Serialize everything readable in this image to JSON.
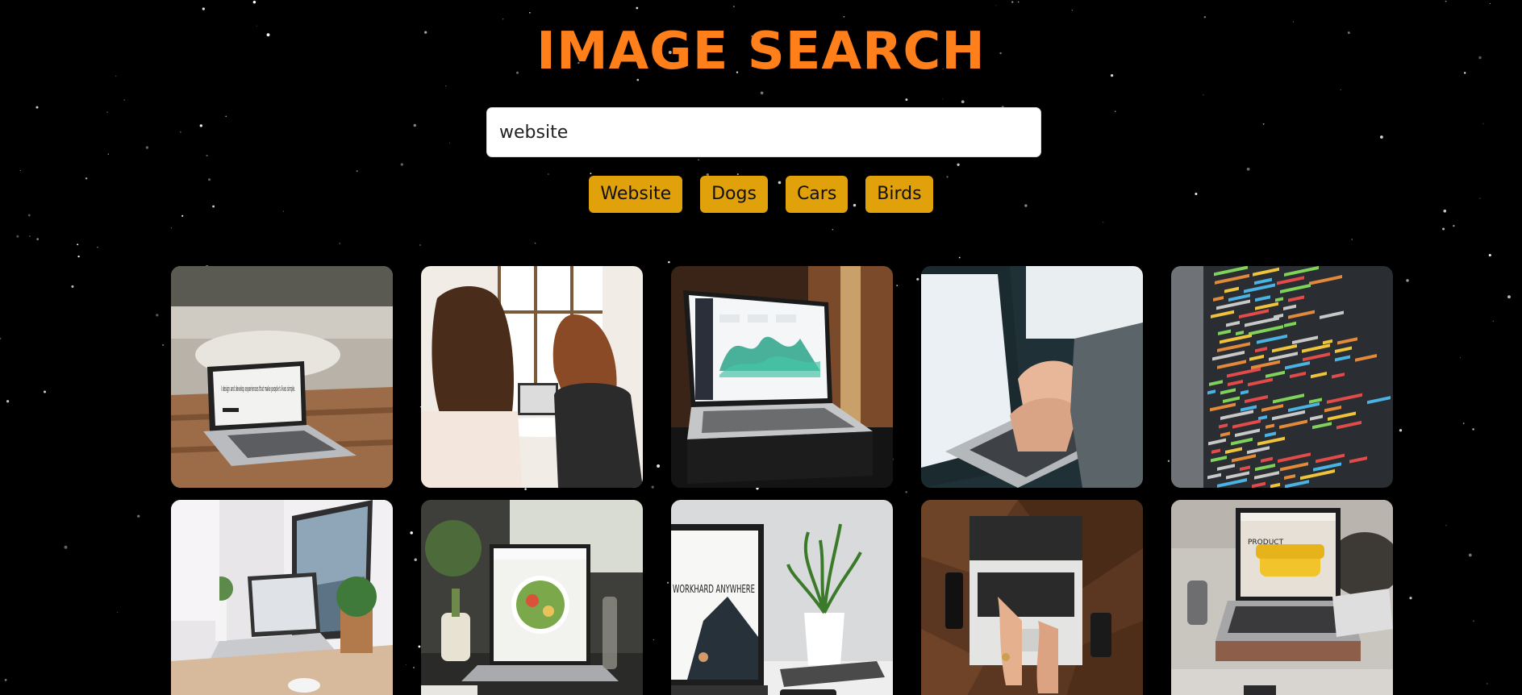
{
  "header": {
    "title": "IMAGE SEARCH"
  },
  "search": {
    "value": "website"
  },
  "chips": [
    "Website",
    "Dogs",
    "Cars",
    "Birds"
  ],
  "results": [
    {
      "icon": "laptop-on-table-image",
      "caption": "I design and develop experiences that make people's lives simple."
    },
    {
      "icon": "two-women-at-laptop-image"
    },
    {
      "icon": "laptop-dashboard-image"
    },
    {
      "icon": "hands-typing-laptop-image"
    },
    {
      "icon": "code-on-screen-image"
    },
    {
      "icon": "desk-with-monitor-and-laptop-image"
    },
    {
      "icon": "laptop-food-website-image"
    },
    {
      "icon": "workhard-anywhere-laptop-image",
      "caption": "WORKHARD ANYWHERE"
    },
    {
      "icon": "laptop-top-view-image"
    },
    {
      "icon": "laptop-product-page-image",
      "caption": "PRODUCT"
    }
  ],
  "colors": {
    "title": "#ff7f1a",
    "chip": "#e0a10a",
    "background": "#000000"
  }
}
